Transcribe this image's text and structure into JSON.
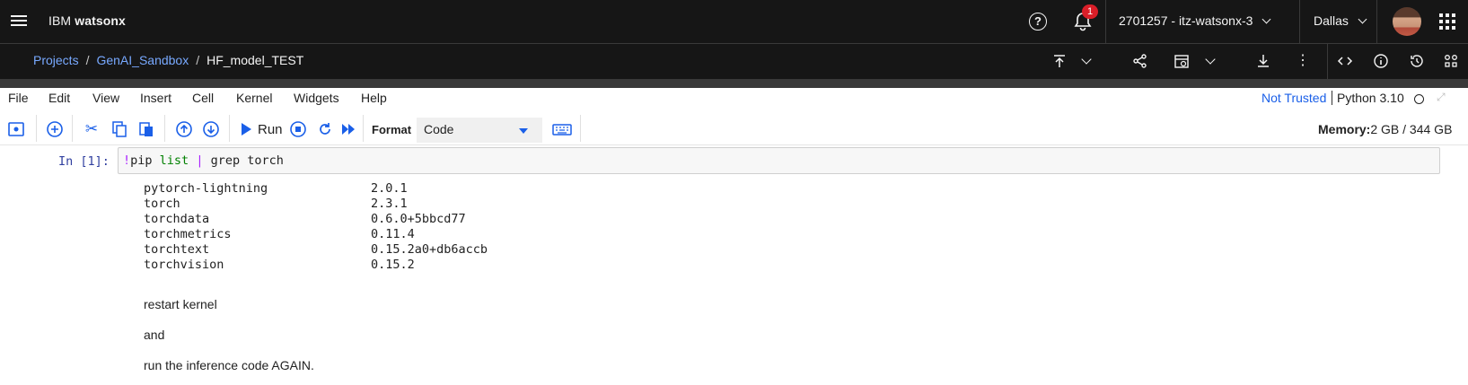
{
  "header": {
    "brand_prefix": "IBM",
    "brand_name": "watsonx",
    "notification_count": "1",
    "account": "2701257 - itz-watsonx-3",
    "region": "Dallas"
  },
  "breadcrumb": {
    "items": [
      "Projects",
      "GenAI_Sandbox"
    ],
    "current": "HF_model_TEST"
  },
  "menubar": {
    "items": [
      "File",
      "Edit",
      "View",
      "Insert",
      "Cell",
      "Kernel",
      "Widgets",
      "Help"
    ],
    "trust_status": "Not Trusted",
    "kernel": "Python 3.10"
  },
  "toolbar": {
    "run_label": "Run",
    "format_label": "Format",
    "format_value": "Code",
    "memory_label": "Memory:",
    "memory_value": "2 GB / 344 GB"
  },
  "cell": {
    "prompt": "In [1]:",
    "code": {
      "bang": "!",
      "cmd": "pip",
      "arg": "list",
      "pipe": "|",
      "rest": "grep torch"
    },
    "output_rows": [
      {
        "pkg": "pytorch-lightning",
        "ver": "2.0.1"
      },
      {
        "pkg": "torch",
        "ver": "2.3.1"
      },
      {
        "pkg": "torchdata",
        "ver": "0.6.0+5bbcd77"
      },
      {
        "pkg": "torchmetrics",
        "ver": "0.11.4"
      },
      {
        "pkg": "torchtext",
        "ver": "0.15.2a0+db6accb"
      },
      {
        "pkg": "torchvision",
        "ver": "0.15.2"
      }
    ]
  },
  "markdown": {
    "line1": "restart kernel",
    "line2": "and",
    "line3": "run the inference code AGAIN."
  },
  "colors": {
    "header_bg": "#161616",
    "link_blue": "#78a9ff",
    "jupyter_blue": "#1a5fe8",
    "badge_red": "#da1e28"
  }
}
